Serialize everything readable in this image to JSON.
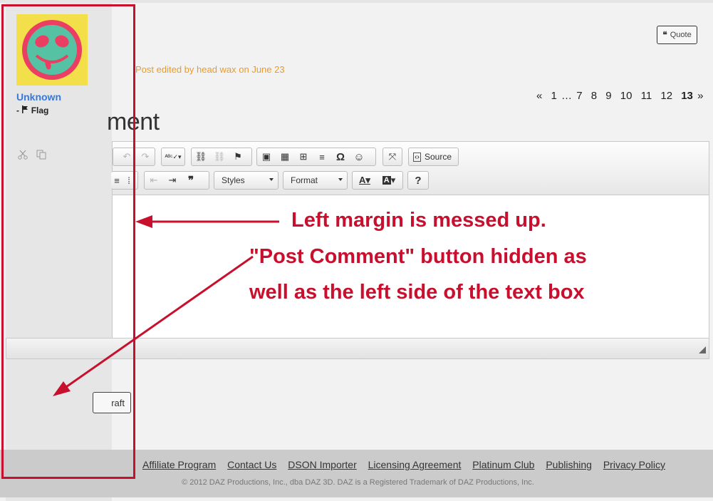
{
  "post": {
    "username": "Unknown",
    "flag_prefix": "-",
    "flag_label": "Flag",
    "quote_label": "Quote",
    "edited_note": "Post edited by head wax on June 23"
  },
  "pagination": {
    "prev": "«",
    "pages": [
      "1",
      "…",
      "7",
      "8",
      "9",
      "10",
      "11",
      "12"
    ],
    "current": "13",
    "next": "»"
  },
  "comment": {
    "heading_visible": "ment",
    "source_label": "Source",
    "styles_label": "Styles",
    "format_label": "Format",
    "help_label": "?",
    "draft_visible": "raft"
  },
  "annotations": {
    "line1": "Left margin is messed up.",
    "line2": "\"Post Comment\" button hidden as",
    "line3": "well as the left side of the text box",
    "color": "#c8102e"
  },
  "footer": {
    "links": [
      "Affiliate Program",
      "Contact Us",
      "DSON Importer",
      "Licensing Agreement",
      "Platinum Club",
      "Publishing",
      "Privacy Policy"
    ],
    "copyright": "© 2012 DAZ Productions, Inc., dba DAZ 3D. DAZ is a Registered Trademark of DAZ Productions, Inc."
  },
  "icons": [
    "avatar-alien-face",
    "flag-icon",
    "scissors-icon",
    "copy-icon",
    "quote-icon",
    "undo-icon",
    "redo-icon",
    "spellcheck-icon",
    "link-icon",
    "unlink-icon",
    "anchor-flag-icon",
    "image-icon",
    "flash-icon",
    "table-icon",
    "horizontal-rule-icon",
    "omega-icon",
    "smiley-icon",
    "maximize-icon",
    "source-icon",
    "list-icon",
    "outdent-icon",
    "indent-icon",
    "blockquote-icon",
    "text-color-icon",
    "bg-color-icon"
  ]
}
